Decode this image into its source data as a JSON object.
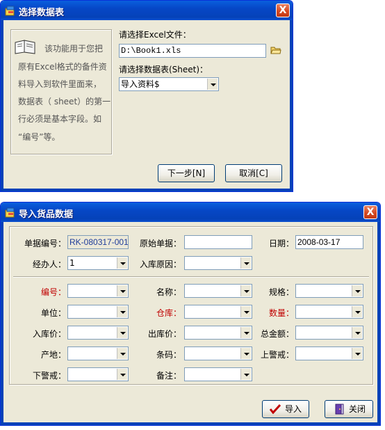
{
  "dialog1": {
    "title": "选择数据表",
    "close_label": "X",
    "info_line1": "该功能用于您把",
    "info_line2": "原有Excel格式的备件资",
    "info_line3": "料导入到软件里面来，",
    "info_line4": "数据表（ sheet）的第一",
    "info_line5": "行必须是基本字段。如",
    "info_line6": "“编号”等。",
    "file_label": "请选择Excel文件：",
    "file_value": "D:\\Book1.xls",
    "sheet_label": "请选择数据表(Sheet)：",
    "sheet_value": "导入资料$",
    "next_label": "下一步[N]",
    "cancel_label": "取消[C]"
  },
  "dialog2": {
    "title": "导入货品数据",
    "close_label": "X",
    "doc_no_label": "单据编号：",
    "doc_no_value": "RK-080317-001",
    "orig_doc_label": "原始单据：",
    "orig_doc_value": "",
    "date_label": "日期：",
    "date_value": "2008-03-17",
    "handler_label": "经办人：",
    "handler_value": "1",
    "reason_label": "入库原因：",
    "reason_value": "",
    "fields": {
      "code": "编号：",
      "name": "名称：",
      "spec": "规格：",
      "unit": "单位：",
      "warehouse": "仓库：",
      "qty": "数量：",
      "in_price": "入库价：",
      "out_price": "出库价：",
      "total": "总金额：",
      "origin": "产地：",
      "barcode": "条码：",
      "upper_alert": "上警戒：",
      "lower_alert": "下警戒：",
      "remark": "备注："
    },
    "import_label": "导入",
    "close_btn_label": "关闭"
  },
  "colors": {
    "title_blue": "#0542b8",
    "required_red": "#c00000",
    "face": "#ece9d8"
  },
  "icons": [
    "app-icon",
    "book-icon",
    "folder-icon",
    "checkmark-icon",
    "door-exit-icon"
  ]
}
